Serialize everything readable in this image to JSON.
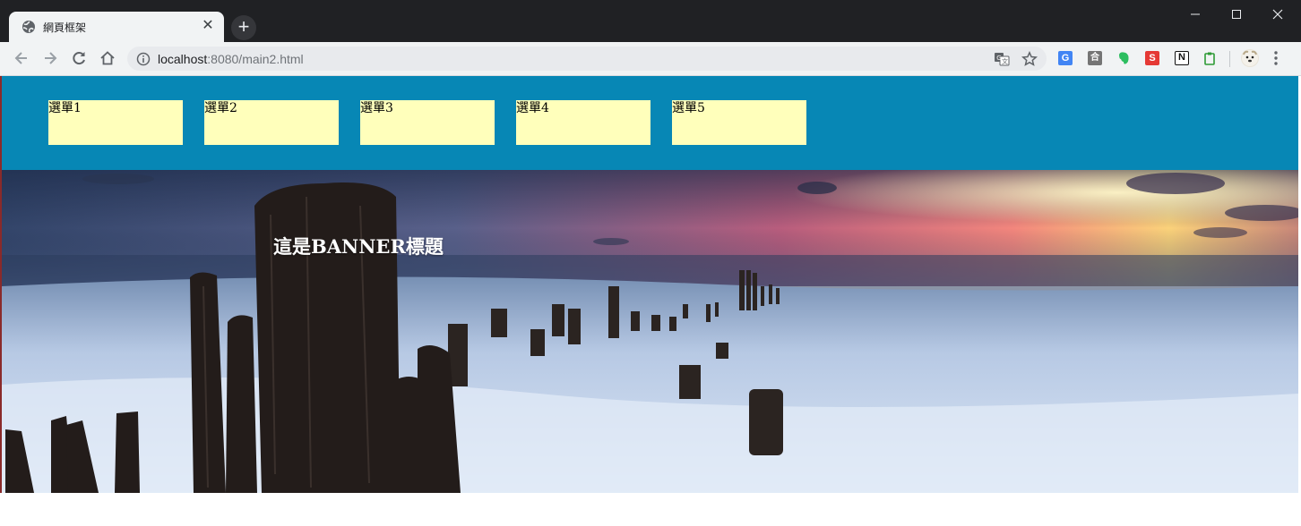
{
  "browser": {
    "tab_title": "網頁框架",
    "tab_close_glyph": "✕",
    "new_tab_glyph": "+",
    "url_host": "localhost",
    "url_rest": ":8080/main2.html",
    "icons": [
      "back-icon",
      "forward-icon",
      "reload-icon",
      "home-icon",
      "info-icon",
      "translate-icon",
      "star-icon"
    ],
    "extensions": [
      {
        "name": "google-translate-extension-icon",
        "color": "#4285f4",
        "glyph": "G"
      },
      {
        "name": "box-extension-icon",
        "color": "#757575",
        "glyph": "合"
      },
      {
        "name": "evernote-extension-icon",
        "color": "#2dbe60",
        "glyph": "e"
      },
      {
        "name": "s-extension-icon",
        "color": "#e53935",
        "glyph": "S"
      },
      {
        "name": "notion-extension-icon",
        "color": "#111111",
        "glyph": "N"
      },
      {
        "name": "clipboard-extension-icon",
        "color": "#2e9a35",
        "glyph": "▢"
      }
    ]
  },
  "header": {
    "bg_color": "#0787b5",
    "menu": [
      {
        "label": "選單1"
      },
      {
        "label": "選單2"
      },
      {
        "label": "選單3"
      },
      {
        "label": "選單4"
      },
      {
        "label": "選單5"
      }
    ],
    "menu_bg": "#ffffbb"
  },
  "banner": {
    "title": "這是BANNER標題"
  }
}
